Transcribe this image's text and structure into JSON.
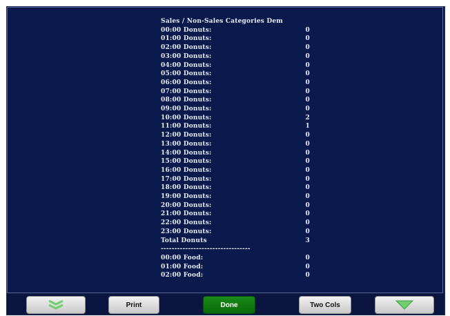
{
  "report": {
    "title": "Sales / Non-Sales Categories Dem",
    "donuts": [
      {
        "label": "00:00 Donuts:",
        "value": "0"
      },
      {
        "label": "01:00 Donuts:",
        "value": "0"
      },
      {
        "label": "02:00 Donuts:",
        "value": "0"
      },
      {
        "label": "03:00 Donuts:",
        "value": "0"
      },
      {
        "label": "04:00 Donuts:",
        "value": "0"
      },
      {
        "label": "05:00 Donuts:",
        "value": "0"
      },
      {
        "label": "06:00 Donuts:",
        "value": "0"
      },
      {
        "label": "07:00 Donuts:",
        "value": "0"
      },
      {
        "label": "08:00 Donuts:",
        "value": "0"
      },
      {
        "label": "09:00 Donuts:",
        "value": "0"
      },
      {
        "label": "10:00 Donuts:",
        "value": "2"
      },
      {
        "label": "11:00 Donuts:",
        "value": "1"
      },
      {
        "label": "12:00 Donuts:",
        "value": "0"
      },
      {
        "label": "13:00 Donuts:",
        "value": "0"
      },
      {
        "label": "14:00 Donuts:",
        "value": "0"
      },
      {
        "label": "15:00 Donuts:",
        "value": "0"
      },
      {
        "label": "16:00 Donuts:",
        "value": "0"
      },
      {
        "label": "17:00 Donuts:",
        "value": "0"
      },
      {
        "label": "18:00 Donuts:",
        "value": "0"
      },
      {
        "label": "19:00 Donuts:",
        "value": "0"
      },
      {
        "label": "20:00 Donuts:",
        "value": "0"
      },
      {
        "label": "21:00 Donuts:",
        "value": "0"
      },
      {
        "label": "22:00 Donuts:",
        "value": "0"
      },
      {
        "label": "23:00 Donuts:",
        "value": "0"
      }
    ],
    "total": {
      "label": "Total Donuts",
      "value": "3"
    },
    "separator": "---------------------------------",
    "food": [
      {
        "label": "00:00 Food:",
        "value": "0"
      },
      {
        "label": "01:00 Food:",
        "value": "0"
      },
      {
        "label": "02:00 Food:",
        "value": "0"
      }
    ]
  },
  "toolbar": {
    "page_up_icon": "double-chevron-down-icon",
    "print_label": "Print",
    "done_label": "Done",
    "two_cols_label": "Two Cols",
    "scroll_down_icon": "triangle-down-icon"
  },
  "colors": {
    "background": "#0b1a4c",
    "text": "#e8ecf6",
    "done_button": "#1a8a1a",
    "arrow_green": "#6fcf6f"
  }
}
